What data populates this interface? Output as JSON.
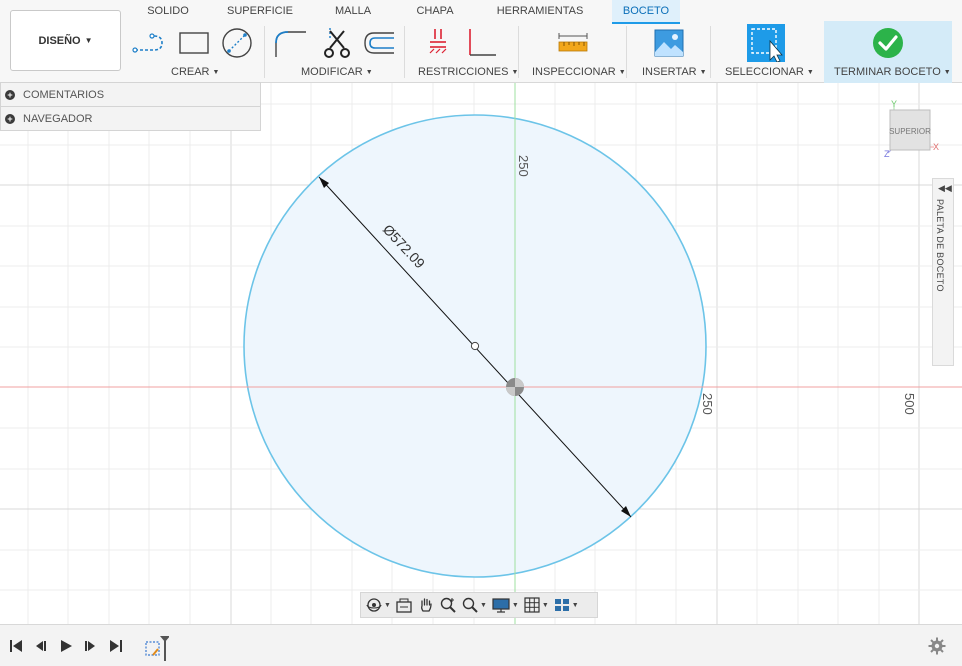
{
  "workspace": {
    "label": "DISEÑO"
  },
  "tabs": [
    {
      "label": "SOLIDO",
      "active": false
    },
    {
      "label": "SUPERFICIE",
      "active": false
    },
    {
      "label": "MALLA",
      "active": false
    },
    {
      "label": "CHAPA",
      "active": false
    },
    {
      "label": "HERRAMIENTAS",
      "active": false
    },
    {
      "label": "BOCETO",
      "active": true
    }
  ],
  "groups": {
    "create": "CREAR",
    "modify": "MODIFICAR",
    "constraints": "RESTRICCIONES",
    "inspect": "INSPECCIONAR",
    "insert": "INSERTAR",
    "select": "SELECCIONAR",
    "finish": "TERMINAR BOCETO"
  },
  "icons": {
    "create": [
      "line-icon",
      "rectangle-icon",
      "circle-icon"
    ],
    "modify": [
      "fillet-icon",
      "trim-icon",
      "offset-icon"
    ],
    "constraints": [
      "fix-constraint-icon",
      "perpendicular-icon"
    ],
    "inspect": "measure-icon",
    "insert": "insert-image-icon",
    "select": "select-icon",
    "finish": "checkmark-icon"
  },
  "browser_panel": {
    "comments": "COMENTARIOS",
    "navigator": "NAVEGADOR"
  },
  "viewcube": {
    "face": "SUPERIOR",
    "axis_y": "Y",
    "axis_x": "X",
    "axis_z": "Z"
  },
  "sketch": {
    "diameter_label": "Ø572.09",
    "ruler_labels": {
      "y_250": "250",
      "x_250": "250",
      "x_500": "500"
    }
  },
  "palette": {
    "label": "PALETA DE BOCETO"
  },
  "navbar": [
    "orbit-icon",
    "look-at-icon",
    "pan-icon",
    "zoom-icon",
    "fit-icon",
    "display-settings-icon",
    "grid-icon",
    "viewports-icon"
  ],
  "colors": {
    "accent": "#1e9be8",
    "circle_stroke": "#6cc4e8",
    "circle_fill": "#eef6fd",
    "x_axis": "#f0a0a0",
    "y_axis": "#9fe0a0",
    "grid": "#e6e6e6",
    "check": "#2cb34a"
  }
}
